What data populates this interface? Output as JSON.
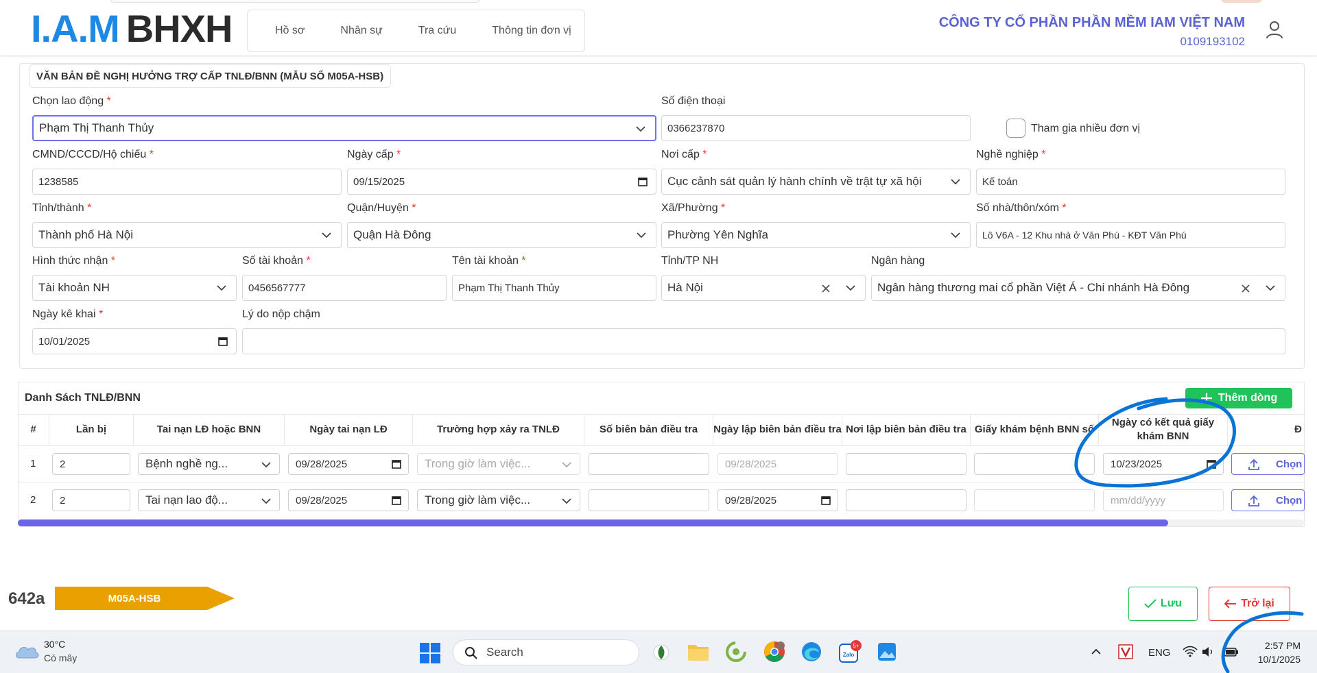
{
  "header": {
    "logo_iam": "I.A.M",
    "logo_bhxh": "BHXH",
    "nav": [
      "Hồ sơ",
      "Nhân sự",
      "Tra cứu",
      "Thông tin đơn vị"
    ],
    "company_name": "CÔNG TY CỔ PHẦN PHẦN MỀM IAM VIỆT NAM",
    "tax_code": "0109193102"
  },
  "form": {
    "legend": "VĂN BẢN ĐỀ NGHỊ HƯỞNG TRỢ CẤP TNLĐ/BNN (MẪU SỐ M05A-HSB)",
    "required_mark": "*",
    "worker_label": "Chọn lao động",
    "worker_value": "Phạm Thị Thanh Thủy",
    "phone_label": "Số điện thoại",
    "phone_value": "0366237870",
    "multi_unit_label": "Tham gia nhiều đơn vị",
    "id_label": "CMND/CCCD/Hộ chiếu",
    "id_value": "1238585",
    "issue_date_label": "Ngày cấp",
    "issue_date_value": "09/15/2025",
    "issue_place_label": "Nơi cấp",
    "issue_place_value": "Cục cảnh sát quản lý hành chính về trật tự xã hội",
    "job_label": "Nghề nghiệp",
    "job_value": "Kế toán",
    "province_label": "Tỉnh/thành",
    "province_value": "Thành phố Hà Nội",
    "district_label": "Quận/Huyện",
    "district_value": "Quận Hà Đông",
    "ward_label": "Xã/Phường",
    "ward_value": "Phường Yên Nghĩa",
    "address_label": "Số nhà/thôn/xóm",
    "address_value": "Lô V6A - 12 Khu nhà ở Văn Phú - KĐT Văn Phú",
    "receive_label": "Hình thức nhận",
    "receive_value": "Tài khoản NH",
    "account_no_label": "Số tài khoản",
    "account_no_value": "0456567777",
    "account_name_label": "Tên tài khoản",
    "account_name_value": "Phạm Thị Thanh Thủy",
    "bank_province_label": "Tỉnh/TP NH",
    "bank_province_value": "Hà Nội",
    "bank_label": "Ngân hàng",
    "bank_value": "Ngân hàng thương mai cổ phần Việt Á - Chi nhánh Hà Đông",
    "declare_date_label": "Ngày kê khai",
    "declare_date_value": "10/01/2025",
    "late_reason_label": "Lý do nộp chậm",
    "late_reason_value": ""
  },
  "table": {
    "title": "Danh Sách TNLĐ/BNN",
    "add_label": "Thêm dòng",
    "headers": [
      "#",
      "Lần bị",
      "Tai nạn LĐ hoặc BNN",
      "Ngày tai nạn LĐ",
      "Trường hợp xảy ra TNLĐ",
      "Số biên bản điều tra",
      "Ngày lập biên bản điều tra",
      "Nơi lập biên bản điều tra",
      "Giấy khám bệnh BNN số",
      "Ngày có kết quả giấy khám BNN",
      "Đ"
    ],
    "rows": [
      {
        "no": "1",
        "times": "2",
        "type": "Bệnh nghề ng...",
        "accident_date": "09/28/2025",
        "case": "Trong giờ làm việc...",
        "report_no": "",
        "report_date": "09/28/2025",
        "report_place": "",
        "exam_no": "",
        "result_date": "10/23/2025",
        "choose": "Chọn"
      },
      {
        "no": "2",
        "times": "2",
        "type": "Tai nạn lao độ...",
        "accident_date": "09/28/2025",
        "case": "Trong giờ làm việc...",
        "report_no": "",
        "report_date": "09/28/2025",
        "report_place": "",
        "exam_no": "",
        "result_date": "mm/dd/yyyy",
        "choose": "Chọn"
      }
    ]
  },
  "footer": {
    "code": "642a",
    "form_tag": "M05A-HSB",
    "save_label": "Lưu",
    "back_label": "Trở lại"
  },
  "taskbar": {
    "temperature": "30°C",
    "weather": "Có mây",
    "search_placeholder": "Search",
    "language": "ENG",
    "time": "2:57 PM",
    "date": "10/1/2025",
    "zalo_badge": "5+",
    "zalo_text": "Zalo"
  },
  "colors": {
    "accent": "#5b63d3",
    "brand_blue": "#1e88e5",
    "green": "#20c35a",
    "red": "#e53935",
    "tag_orange": "#e8a100",
    "annotation_blue": "#0a74d6"
  }
}
